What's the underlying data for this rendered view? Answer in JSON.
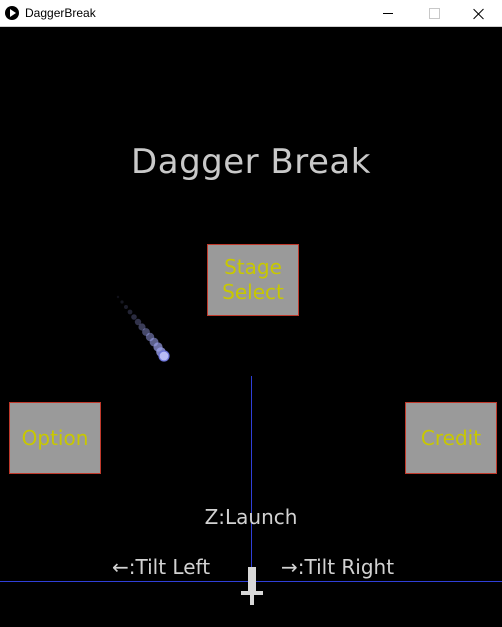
{
  "window": {
    "title": "DaggerBreak",
    "icon": "play-circle-icon"
  },
  "game": {
    "title": "Dagger Break",
    "menu": {
      "stage_select": "Stage\nSelect",
      "option": "Option",
      "credit": "Credit"
    },
    "controls": {
      "launch": "Z:Launch",
      "tilt_left": "←:Tilt Left",
      "tilt_right": "→:Tilt Right"
    },
    "colors": {
      "background": "#000000",
      "title_text": "#c9c9c9",
      "button_fill": "#9a9a9a",
      "button_border": "#c0392b",
      "button_text": "#c8c800",
      "guide_line": "#2f3fd8",
      "ball": "#9aa0e8"
    }
  }
}
